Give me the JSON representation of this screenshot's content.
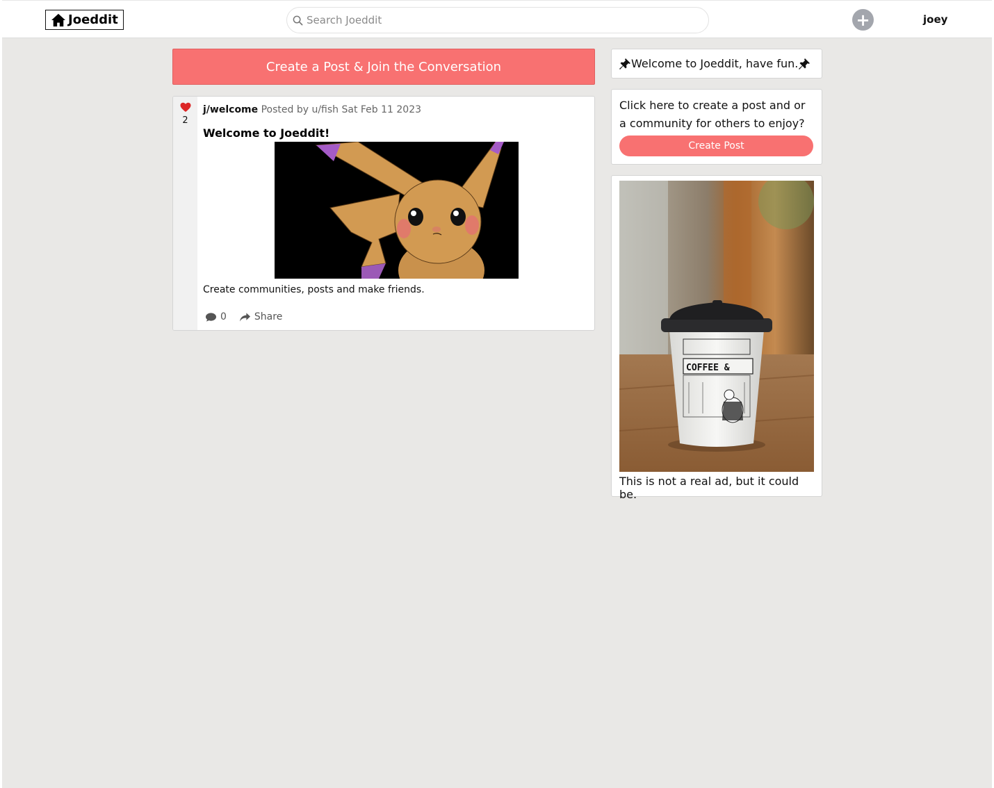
{
  "header": {
    "logo_text": "Joeddit",
    "search_placeholder": "Search Joeddit",
    "add_label": "+",
    "username": "joey"
  },
  "banner": {
    "label": "Create a Post & Join the Conversation"
  },
  "post": {
    "likes": "2",
    "community": "j/welcome",
    "posted_by": "Posted by u/fish Sat Feb 11 2023",
    "title": "Welcome to Joeddit!",
    "body": "Create communities, posts and make friends.",
    "comment_count": "0",
    "share_label": "Share"
  },
  "sidebar": {
    "welcome_text": "Welcome to Joeddit, have fun.",
    "create_prompt": "Click here to create a post and or a community for others to enjoy?",
    "create_button": "Create Post",
    "ad_caption": "This is not a real ad, but it could be.",
    "ad_cup_text": "COFFEE &"
  },
  "colors": {
    "accent": "#f87171",
    "like": "#dc2626",
    "background": "#e9e8e6"
  }
}
